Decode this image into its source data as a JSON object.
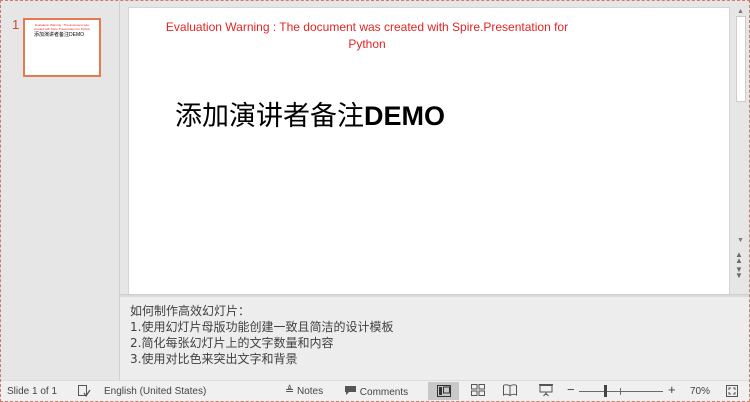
{
  "thumbnails": [
    {
      "number": "1",
      "warning": "Evaluation Warning : The document was created with Spire.Presentation for Python",
      "title": "添加演讲者备注DEMO"
    }
  ],
  "slide": {
    "warning": "Evaluation Warning : The document was created with Spire.Presentation for Python",
    "title_cjk": "添加演讲者备注",
    "title_latin": "DEMO"
  },
  "notes": {
    "lines": [
      "如何制作高效幻灯片：",
      "1.使用幻灯片母版功能创建一致且简洁的设计模板",
      "2.简化每张幻灯片上的文字数量和内容",
      "3.使用对比色来突出文字和背景"
    ]
  },
  "status": {
    "slide_counter": "Slide 1 of 1",
    "language": "English (United States)",
    "notes_label": "Notes",
    "comments_label": "Comments",
    "zoom": "70%",
    "zoom_fraction": 0.31
  },
  "icons": {
    "spell_check": "spell-check-icon",
    "notes": "notes-icon",
    "comments": "comments-icon",
    "normal_view": "normal-view-icon",
    "slide_sorter": "slide-sorter-icon",
    "reading_view": "reading-view-icon",
    "slideshow": "slideshow-icon",
    "fit_to_window": "fit-window-icon"
  },
  "colors": {
    "warning_text": "#e52323",
    "thumbnail_selected_border": "#e8794f",
    "thumbnail_number": "#c94f33"
  }
}
